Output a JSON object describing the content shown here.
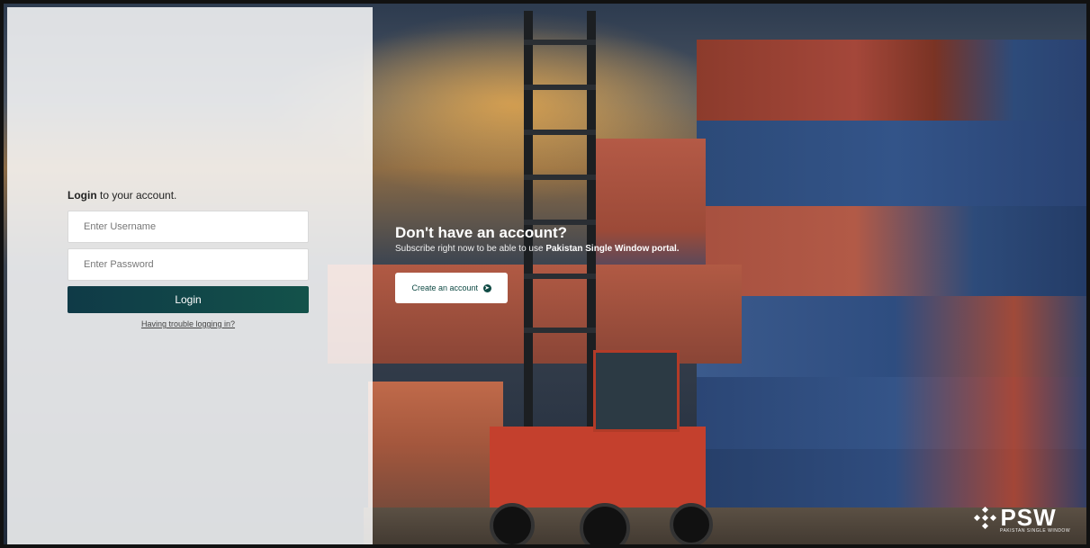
{
  "login": {
    "title_bold": "Login",
    "title_rest": " to your account.",
    "username_placeholder": "Enter Username",
    "password_placeholder": "Enter Password",
    "button_label": "Login",
    "trouble_link": "Having trouble logging in?"
  },
  "signup": {
    "heading": "Don't have an account?",
    "sub_prefix": "Subscribe right now to be able to use ",
    "sub_bold": "Pakistan Single Window portal.",
    "button_label": "Create an account",
    "button_icon": "arrow-right-circle-icon"
  },
  "brand": {
    "logo_text": "PSW",
    "logo_subtitle": "PAKISTAN SINGLE WINDOW",
    "accent_color": "#0f4a44"
  }
}
